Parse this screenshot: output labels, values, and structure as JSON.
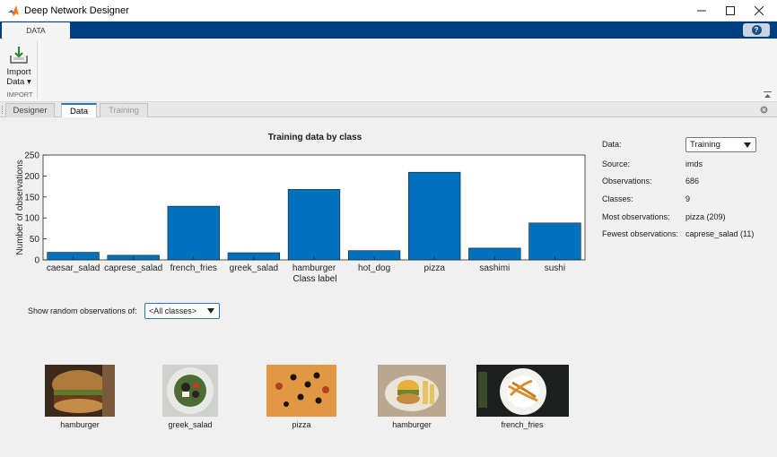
{
  "window": {
    "title": "Deep Network Designer"
  },
  "ribbon": {
    "tab_label": "DATA",
    "help_label": "?"
  },
  "toolstrip": {
    "import_label_line1": "Import",
    "import_label_line2": "Data ▾",
    "group_label": "IMPORT"
  },
  "doc_tabs": [
    "Designer",
    "Data",
    "Training"
  ],
  "chart_data": {
    "type": "bar",
    "title": "Training data by class",
    "xlabel": "Class label",
    "ylabel": "Number of observations",
    "categories": [
      "caesar_salad",
      "caprese_salad",
      "french_fries",
      "greek_salad",
      "hamburger",
      "hot_dog",
      "pizza",
      "sashimi",
      "sushi"
    ],
    "values": [
      18,
      11,
      128,
      17,
      168,
      22,
      209,
      28,
      88
    ],
    "ylim": [
      0,
      250
    ],
    "yticks": [
      0,
      50,
      100,
      150,
      200,
      250
    ],
    "bar_color": "#0072bd",
    "grid": false
  },
  "info": {
    "data_label": "Data:",
    "data_value": "Training",
    "rows": [
      {
        "label": "Source:",
        "value": "imds"
      },
      {
        "label": "Observations:",
        "value": "686"
      },
      {
        "label": "Classes:",
        "value": "9"
      },
      {
        "label": "Most observations:",
        "value": "pizza (209)"
      },
      {
        "label": "Fewest observations:",
        "value": "caprese_salad (11)"
      }
    ]
  },
  "random": {
    "label": "Show random observations of:",
    "selected": "<All classes>"
  },
  "thumbnails": [
    {
      "label": "hamburger"
    },
    {
      "label": "greek_salad"
    },
    {
      "label": "pizza"
    },
    {
      "label": "hamburger"
    },
    {
      "label": "french_fries"
    }
  ]
}
